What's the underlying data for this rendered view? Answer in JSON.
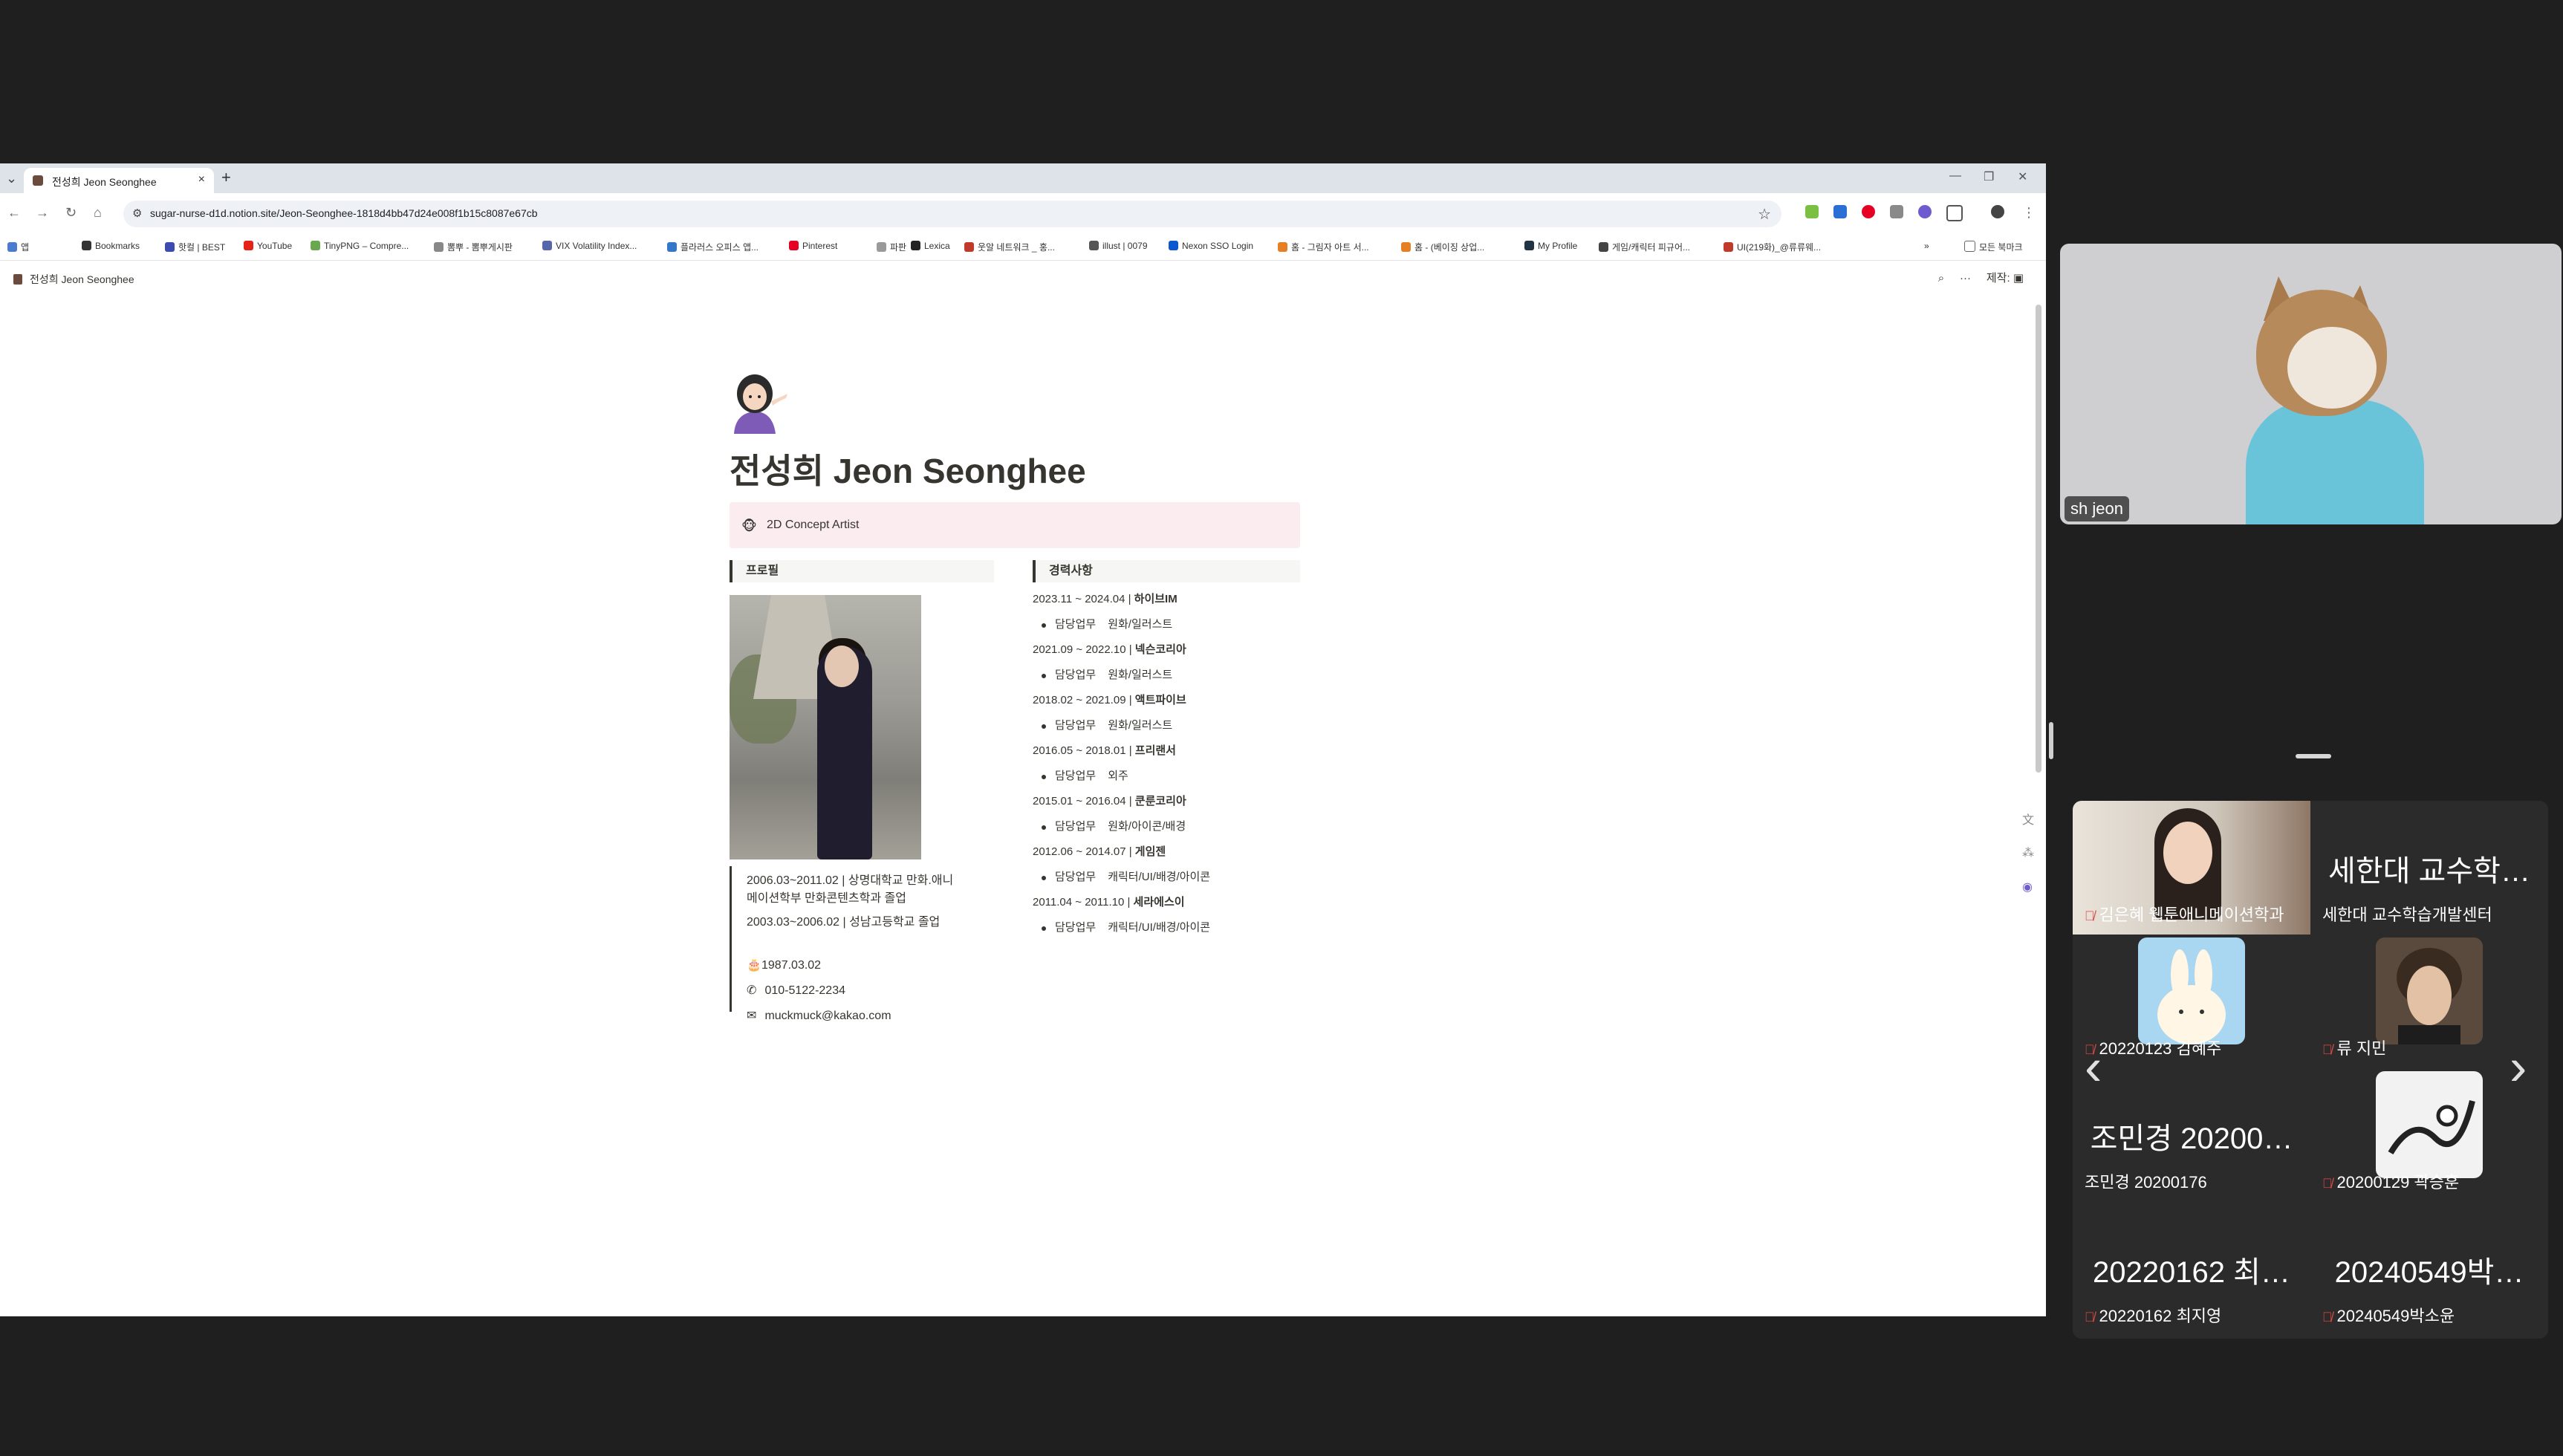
{
  "browser": {
    "tab_title": "전성희 Jeon Seonghee",
    "new_tab_symbol": "+",
    "url": "sugar-nurse-d1d.notion.site/Jeon-Seonghee-1818d4bb47d24e008f1b15c8087e67cb",
    "bookmarks": [
      {
        "label": "앱",
        "color": "#4a7bd0"
      },
      {
        "label": "Bookmarks",
        "color": "#333333"
      },
      {
        "label": "핫컬 | BEST",
        "color": "#3b4bb0"
      },
      {
        "label": "YouTube",
        "color": "#e62117"
      },
      {
        "label": "TinyPNG – Compre...",
        "color": "#6aa84f"
      },
      {
        "label": "뽐뿌 - 뽐뿌게시판",
        "color": "#888888"
      },
      {
        "label": "VIX Volatility Index...",
        "color": "#5566aa"
      },
      {
        "label": "플라러스 오피스 앱...",
        "color": "#3377cc"
      },
      {
        "label": "Pinterest",
        "color": "#e60023"
      },
      {
        "label": "파판",
        "color": "#999999"
      },
      {
        "label": "Lexica",
        "color": "#222222"
      },
      {
        "label": "웃알 네트워크 _ 홍...",
        "color": "#c0392b"
      },
      {
        "label": "illust | 0079",
        "color": "#555555"
      },
      {
        "label": "Nexon SSO Login",
        "color": "#0b57d0"
      },
      {
        "label": "홈 - 그림자 아트 서...",
        "color": "#e67e22"
      },
      {
        "label": "홈 - (베이징 상업...",
        "color": "#e67e22"
      },
      {
        "label": "My Profile",
        "color": "#223344"
      },
      {
        "label": "게임/캐릭터 피규어...",
        "color": "#444444"
      },
      {
        "label": "UI(219화)_@류류웨...",
        "color": "#c0392b"
      }
    ],
    "bookmarks_more": "»",
    "all_bookmarks": "모든 북마크"
  },
  "notion": {
    "breadcrumb": "전성희 Jeon Seonghee",
    "edit_label": "제작:",
    "title": "전성희 Jeon Seonghee",
    "callout_icon": "🐵",
    "callout_text": "2D Concept Artist",
    "profile": {
      "heading": "프로필",
      "edu1": "2006.03~2011.02 | 상명대학교 만화.애니",
      "edu1b": "메이션학부 만화콘텐츠학과 졸업",
      "edu2": "2003.03~2006.02 | 성남고등학교 졸업",
      "birth": "1987.03.02",
      "phone": "010-5122-2234",
      "email": "muckmuck@kakao.com"
    },
    "career": {
      "heading": "경력사항",
      "duty_label": "담당업무",
      "items": [
        {
          "period": "2023.11 ~ 2024.04 | ",
          "company": "하이브IM",
          "duty": "원화/일러스트"
        },
        {
          "period": "2021.09 ~ 2022.10 | ",
          "company": "넥슨코리아",
          "duty": "원화/일러스트"
        },
        {
          "period": "2018.02 ~ 2021.09 | ",
          "company": "액트파이브",
          "duty": "원화/일러스트"
        },
        {
          "period": "2016.05 ~ 2018.01 | ",
          "company": "프리랜서",
          "duty": "외주"
        },
        {
          "period": "2015.01 ~ 2016.04 | ",
          "company": "쿤룬코리아",
          "duty": "원화/아이콘/배경"
        },
        {
          "period": "2012.06 ~ 2014.07 | ",
          "company": "게임젠",
          "duty": "캐릭터/UI/배경/아이콘"
        },
        {
          "period": "2011.04 ~ 2011.10 | ",
          "company": "세라에스이",
          "duty": "캐릭터/UI/배경/아이콘"
        }
      ]
    }
  },
  "meeting": {
    "self_name": "sh jeon",
    "participants": [
      {
        "big": "",
        "label": "김은혜 웹툰애니메이션학과",
        "muted": true,
        "video": "person"
      },
      {
        "big": "세한대 교수학…",
        "label": "세한대 교수학습개발센터",
        "muted": false,
        "video": ""
      },
      {
        "big": "",
        "label": "20220123 김혜주",
        "muted": true,
        "video": "bunny"
      },
      {
        "big": "",
        "label": "류 지민",
        "muted": true,
        "video": "man"
      },
      {
        "big": "조민경 20200…",
        "label": "조민경 20200176",
        "muted": false,
        "video": ""
      },
      {
        "big": "",
        "label": "20200129 곽승훈",
        "muted": true,
        "video": "doodle"
      },
      {
        "big": "20220162 최…",
        "label": "20220162 최지영",
        "muted": true,
        "video": ""
      },
      {
        "big": "20240549박…",
        "label": "20240549박소윤",
        "muted": true,
        "video": ""
      }
    ]
  }
}
